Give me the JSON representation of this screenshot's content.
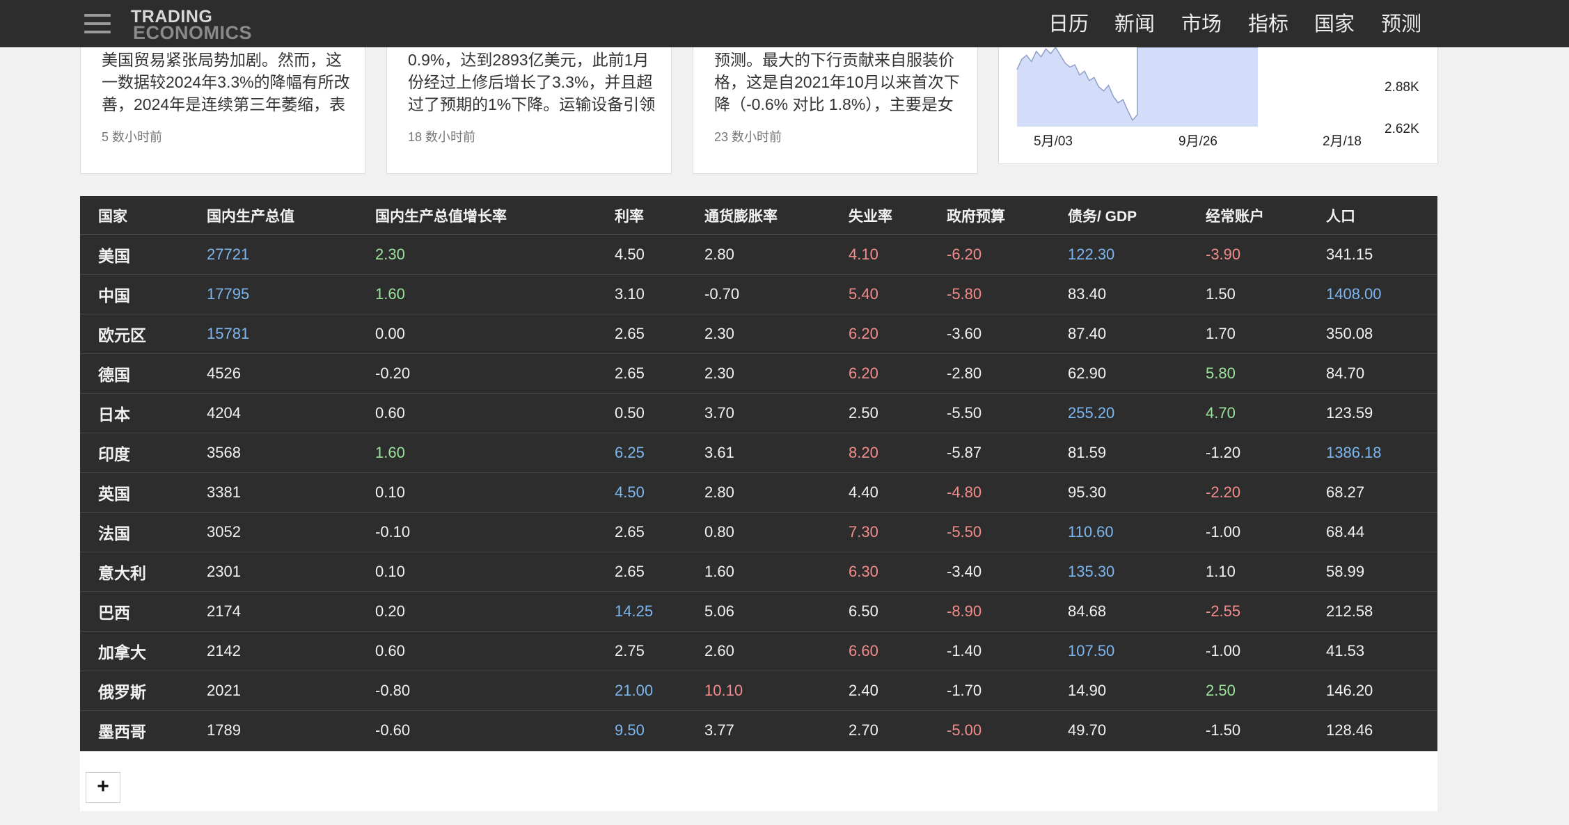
{
  "nav": {
    "logo_line1": "TRADING",
    "logo_line2": "ECONOMICS",
    "items": [
      "日历",
      "新闻",
      "市场",
      "指标",
      "国家",
      "预测"
    ]
  },
  "news": [
    {
      "lines": [
        "美国贸易紧张局势加剧。然而，这",
        "一数据较2024年3.3%的降幅有所改",
        "善，2024年是连续第三年萎缩，表"
      ],
      "time": "5 数小时前"
    },
    {
      "lines": [
        "0.9%，达到2893亿美元，此前1月",
        "份经过上修后增长了3.3%，并且超",
        "过了预期的1%下降。运输设备引领"
      ],
      "time": "18 数小时前"
    },
    {
      "lines": [
        "预测。最大的下行贡献来自服装价",
        "格，这是自2021年10月以来首次下",
        "降（-0.6% 对比 1.8%），主要是女"
      ],
      "time": "23 数小时前"
    }
  ],
  "chart_data": {
    "type": "area",
    "x_ticks": [
      "5月/03",
      "9月/26",
      "2月/18"
    ],
    "y_ticks": [
      "2.88K",
      "2.62K"
    ],
    "fill_color": "#d3dcf8",
    "line_color": "#8fa0c8"
  },
  "table": {
    "headers": [
      "国家",
      "国内生产总值",
      "国内生产总值增长率",
      "利率",
      "通货膨胀率",
      "失业率",
      "政府预算",
      "债务/ GDP",
      "经常账户",
      "人口"
    ],
    "rows": [
      [
        {
          "v": "美国"
        },
        {
          "v": "27721",
          "c": "blue"
        },
        {
          "v": "2.30",
          "c": "green"
        },
        {
          "v": "4.50"
        },
        {
          "v": "2.80"
        },
        {
          "v": "4.10",
          "c": "red"
        },
        {
          "v": "-6.20",
          "c": "red"
        },
        {
          "v": "122.30",
          "c": "blue"
        },
        {
          "v": "-3.90",
          "c": "red"
        },
        {
          "v": "341.15"
        }
      ],
      [
        {
          "v": "中国"
        },
        {
          "v": "17795",
          "c": "blue"
        },
        {
          "v": "1.60",
          "c": "green"
        },
        {
          "v": "3.10"
        },
        {
          "v": "-0.70"
        },
        {
          "v": "5.40",
          "c": "red"
        },
        {
          "v": "-5.80",
          "c": "red"
        },
        {
          "v": "83.40"
        },
        {
          "v": "1.50"
        },
        {
          "v": "1408.00",
          "c": "blue"
        }
      ],
      [
        {
          "v": "欧元区"
        },
        {
          "v": "15781",
          "c": "blue"
        },
        {
          "v": "0.00"
        },
        {
          "v": "2.65"
        },
        {
          "v": "2.30"
        },
        {
          "v": "6.20",
          "c": "red"
        },
        {
          "v": "-3.60"
        },
        {
          "v": "87.40"
        },
        {
          "v": "1.70"
        },
        {
          "v": "350.08"
        }
      ],
      [
        {
          "v": "德国"
        },
        {
          "v": "4526"
        },
        {
          "v": "-0.20"
        },
        {
          "v": "2.65"
        },
        {
          "v": "2.30"
        },
        {
          "v": "6.20",
          "c": "red"
        },
        {
          "v": "-2.80"
        },
        {
          "v": "62.90"
        },
        {
          "v": "5.80",
          "c": "green"
        },
        {
          "v": "84.70"
        }
      ],
      [
        {
          "v": "日本"
        },
        {
          "v": "4204"
        },
        {
          "v": "0.60"
        },
        {
          "v": "0.50"
        },
        {
          "v": "3.70"
        },
        {
          "v": "2.50"
        },
        {
          "v": "-5.50"
        },
        {
          "v": "255.20",
          "c": "blue"
        },
        {
          "v": "4.70",
          "c": "green"
        },
        {
          "v": "123.59"
        }
      ],
      [
        {
          "v": "印度"
        },
        {
          "v": "3568"
        },
        {
          "v": "1.60",
          "c": "green"
        },
        {
          "v": "6.25",
          "c": "blue"
        },
        {
          "v": "3.61"
        },
        {
          "v": "8.20",
          "c": "red"
        },
        {
          "v": "-5.87"
        },
        {
          "v": "81.59"
        },
        {
          "v": "-1.20"
        },
        {
          "v": "1386.18",
          "c": "blue"
        }
      ],
      [
        {
          "v": "英国"
        },
        {
          "v": "3381"
        },
        {
          "v": "0.10"
        },
        {
          "v": "4.50",
          "c": "blue"
        },
        {
          "v": "2.80"
        },
        {
          "v": "4.40"
        },
        {
          "v": "-4.80",
          "c": "red"
        },
        {
          "v": "95.30"
        },
        {
          "v": "-2.20",
          "c": "red"
        },
        {
          "v": "68.27"
        }
      ],
      [
        {
          "v": "法国"
        },
        {
          "v": "3052"
        },
        {
          "v": "-0.10"
        },
        {
          "v": "2.65"
        },
        {
          "v": "0.80"
        },
        {
          "v": "7.30",
          "c": "red"
        },
        {
          "v": "-5.50",
          "c": "red"
        },
        {
          "v": "110.60",
          "c": "blue"
        },
        {
          "v": "-1.00"
        },
        {
          "v": "68.44"
        }
      ],
      [
        {
          "v": "意大利"
        },
        {
          "v": "2301"
        },
        {
          "v": "0.10"
        },
        {
          "v": "2.65"
        },
        {
          "v": "1.60"
        },
        {
          "v": "6.30",
          "c": "red"
        },
        {
          "v": "-3.40"
        },
        {
          "v": "135.30",
          "c": "blue"
        },
        {
          "v": "1.10"
        },
        {
          "v": "58.99"
        }
      ],
      [
        {
          "v": "巴西"
        },
        {
          "v": "2174"
        },
        {
          "v": "0.20"
        },
        {
          "v": "14.25",
          "c": "blue"
        },
        {
          "v": "5.06"
        },
        {
          "v": "6.50"
        },
        {
          "v": "-8.90",
          "c": "red"
        },
        {
          "v": "84.68"
        },
        {
          "v": "-2.55",
          "c": "red"
        },
        {
          "v": "212.58"
        }
      ],
      [
        {
          "v": "加拿大"
        },
        {
          "v": "2142"
        },
        {
          "v": "0.60"
        },
        {
          "v": "2.75"
        },
        {
          "v": "2.60"
        },
        {
          "v": "6.60",
          "c": "red"
        },
        {
          "v": "-1.40"
        },
        {
          "v": "107.50",
          "c": "blue"
        },
        {
          "v": "-1.00"
        },
        {
          "v": "41.53"
        }
      ],
      [
        {
          "v": "俄罗斯"
        },
        {
          "v": "2021"
        },
        {
          "v": "-0.80"
        },
        {
          "v": "21.00",
          "c": "blue"
        },
        {
          "v": "10.10",
          "c": "red"
        },
        {
          "v": "2.40"
        },
        {
          "v": "-1.70"
        },
        {
          "v": "14.90"
        },
        {
          "v": "2.50",
          "c": "green"
        },
        {
          "v": "146.20"
        }
      ],
      [
        {
          "v": "墨西哥"
        },
        {
          "v": "1789"
        },
        {
          "v": "-0.60"
        },
        {
          "v": "9.50",
          "c": "blue"
        },
        {
          "v": "3.77"
        },
        {
          "v": "2.70"
        },
        {
          "v": "-5.00",
          "c": "red"
        },
        {
          "v": "49.70"
        },
        {
          "v": "-1.50"
        },
        {
          "v": "128.46"
        }
      ]
    ]
  },
  "add_button_label": "+"
}
